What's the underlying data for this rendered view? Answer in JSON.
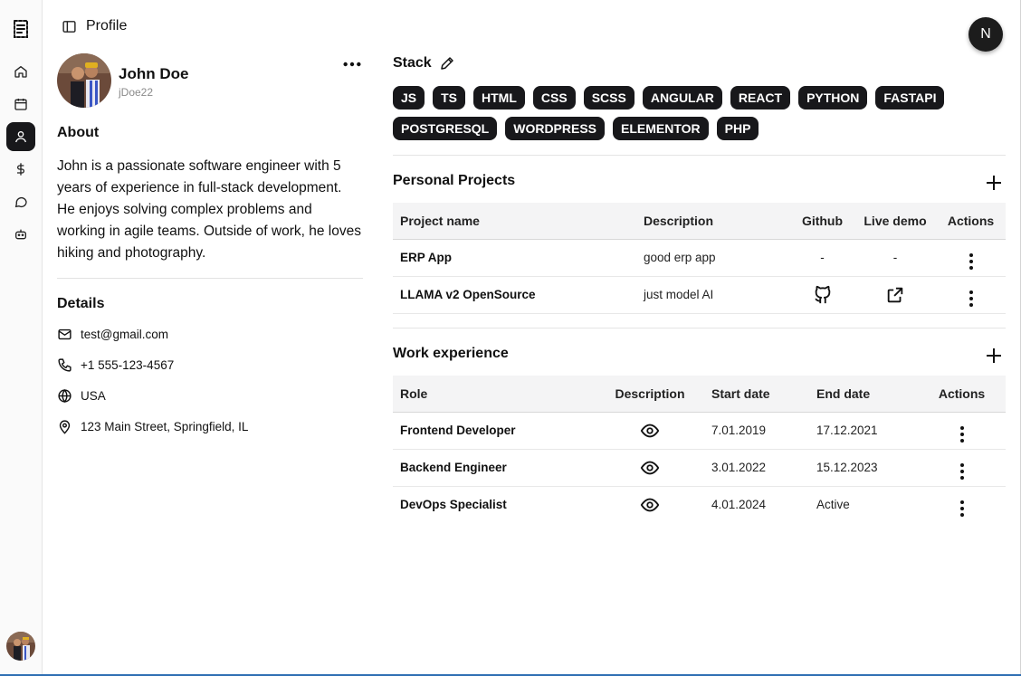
{
  "header": {
    "title": "Profile",
    "top_avatar_letter": "N"
  },
  "sidebar": {
    "items": [
      {
        "name": "home",
        "icon": "home-icon",
        "active": false
      },
      {
        "name": "calendar",
        "icon": "calendar-icon",
        "active": false
      },
      {
        "name": "profile",
        "icon": "user-icon",
        "active": true
      },
      {
        "name": "billing",
        "icon": "dollar-icon",
        "active": false
      },
      {
        "name": "chat",
        "icon": "chat-icon",
        "active": false
      },
      {
        "name": "bot",
        "icon": "bot-icon",
        "active": false
      }
    ]
  },
  "profile": {
    "name": "John Doe",
    "username": "jDoe22",
    "about_title": "About",
    "about_text": "John is a passionate software engineer with 5 years of experience in full-stack development. He enjoys solving complex problems and working in agile teams. Outside of work, he loves hiking and photography.",
    "details_title": "Details",
    "email": "test@gmail.com",
    "phone": "+1 555-123-4567",
    "country": "USA",
    "address": "123 Main Street, Springfield, IL"
  },
  "stack": {
    "title": "Stack",
    "tags": [
      "JS",
      "TS",
      "HTML",
      "CSS",
      "SCSS",
      "ANGULAR",
      "REACT",
      "PYTHON",
      "FASTAPI",
      "POSTGRESQL",
      "WORDPRESS",
      "ELEMENTOR",
      "PHP"
    ]
  },
  "projects": {
    "title": "Personal Projects",
    "columns": [
      "Project name",
      "Description",
      "Github",
      "Live demo",
      "Actions"
    ],
    "rows": [
      {
        "name": "ERP App",
        "description": "good erp app",
        "github": "-",
        "demo": "-"
      },
      {
        "name": "LLAMA v2 OpenSource",
        "description": "just model AI",
        "github": "github-icon",
        "demo": "external-link-icon"
      }
    ]
  },
  "work": {
    "title": "Work experience",
    "columns": [
      "Role",
      "Description",
      "Start date",
      "End date",
      "Actions"
    ],
    "rows": [
      {
        "role": "Frontend Developer",
        "start": "7.01.2019",
        "end": "17.12.2021"
      },
      {
        "role": "Backend Engineer",
        "start": "3.01.2022",
        "end": "15.12.2023"
      },
      {
        "role": "DevOps Specialist",
        "start": "4.01.2024",
        "end": "Active"
      }
    ]
  },
  "colors": {
    "accent": "#18181b",
    "header_bg": "#f4f4f5"
  }
}
